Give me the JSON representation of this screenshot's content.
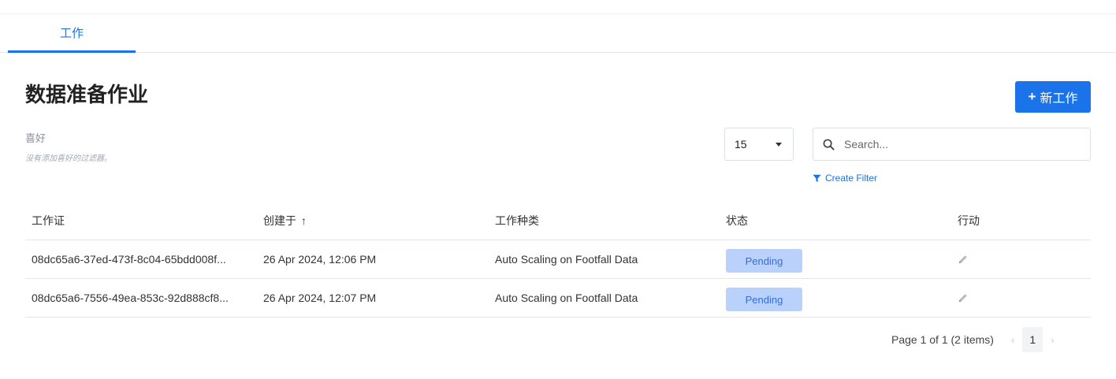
{
  "tabs": [
    {
      "label": "工作"
    }
  ],
  "page": {
    "title": "数据准备作业"
  },
  "new_button": {
    "label": "新工作",
    "icon": "plus-icon"
  },
  "favorites": {
    "label": "喜好",
    "empty_text": "没有添加喜好的过滤器。"
  },
  "page_size": {
    "value": "15"
  },
  "search": {
    "placeholder": "Search..."
  },
  "create_filter": {
    "label": "Create Filter",
    "icon": "filter-icon"
  },
  "table": {
    "columns": [
      "工作证",
      "创建于",
      "工作种类",
      "状态",
      "行动"
    ],
    "sort_indicator": "↑",
    "rows": [
      {
        "id": "08dc65a6-37ed-473f-8c04-65bdd008f...",
        "created": "26 Apr 2024, 12:06 PM",
        "type": "Auto Scaling on Footfall Data",
        "status": "Pending"
      },
      {
        "id": "08dc65a6-7556-49ea-853c-92d888cf8...",
        "created": "26 Apr 2024, 12:07 PM",
        "type": "Auto Scaling on Footfall Data",
        "status": "Pending"
      }
    ]
  },
  "pagination": {
    "summary": "Page 1 of 1 (2 items)",
    "current_page": "1",
    "prev": "‹",
    "next": "›"
  },
  "colors": {
    "accent": "#1a73e8",
    "badge_bg": "#b9d1fb",
    "badge_text": "#2f6fe4"
  }
}
